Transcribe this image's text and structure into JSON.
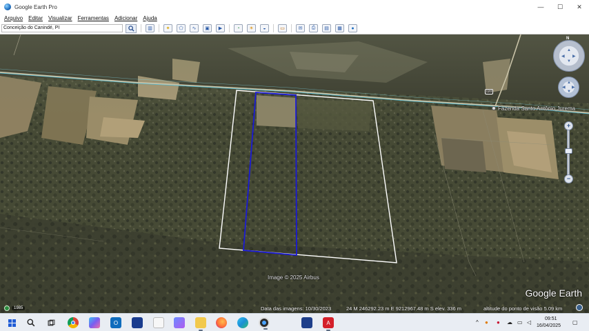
{
  "window": {
    "title": "Google Earth Pro",
    "controls": {
      "minimize": "—",
      "maximize": "☐",
      "close": "✕"
    }
  },
  "menu": {
    "items": [
      "Arquivo",
      "Editar",
      "Visualizar",
      "Ferramentas",
      "Adicionar",
      "Ajuda"
    ]
  },
  "toolbar": {
    "search_value": "Conceição do Canindé, PI",
    "icons": [
      "sidebar-toggle-icon",
      "placemark-icon",
      "polygon-icon",
      "path-icon",
      "image-overlay-icon",
      "record-tour-icon",
      "historical-imagery-icon",
      "sunlight-icon",
      "planets-icon",
      "ruler-icon",
      "email-icon",
      "print-icon",
      "save-image-icon",
      "view-in-maps-icon",
      "earth-globe-icon"
    ]
  },
  "map": {
    "imagery_credit": "Image © 2025 Airbus",
    "logo_text": "Google Earth",
    "road_marker": "020",
    "place_label": "Fazenda Santo Antônio Jurema",
    "compass_north": "N"
  },
  "status": {
    "year": "1985",
    "imagery_date": "Data das imagens: 10/30/2023",
    "coordinates": "24 M 246292.23 m E 9212967.48 m S   elev.  336 m",
    "eye_altitude": "altitude do ponto de visão   5.09 km"
  },
  "taskbar": {
    "time": "09:51",
    "date": "16/04/2025",
    "apps": [
      {
        "name": "start-button",
        "color": "#1e5bd6",
        "glyph": "⊞"
      },
      {
        "name": "search-button",
        "color": "#e9edf3",
        "glyph": "⌕"
      },
      {
        "name": "task-view-button",
        "color": "#e9edf3",
        "glyph": "▭"
      },
      {
        "name": "chrome-app",
        "color": "#db4437",
        "glyph": "●"
      },
      {
        "name": "copilot-app",
        "color": "#7a5cf0",
        "glyph": "◆"
      },
      {
        "name": "outlook-app",
        "color": "#0f6cbd",
        "glyph": "O"
      },
      {
        "name": "news-app",
        "color": "#1a3c8e",
        "glyph": "■"
      },
      {
        "name": "file-app",
        "color": "#f1f1f1",
        "glyph": "▯"
      },
      {
        "name": "copilot-alt-app",
        "color": "#9b5de5",
        "glyph": "◈"
      },
      {
        "name": "file-explorer-app",
        "color": "#f2c94c",
        "glyph": "▬"
      },
      {
        "name": "firefox-app",
        "color": "#ff7139",
        "glyph": "●"
      },
      {
        "name": "edge-app",
        "color": "#1b8fd6",
        "glyph": "◐"
      },
      {
        "name": "earth-pro-app",
        "color": "#2b2b2b",
        "glyph": "◉"
      },
      {
        "name": "monitor-app",
        "color": "#1e3f8a",
        "glyph": "▤"
      },
      {
        "name": "acrobat-app",
        "color": "#d4202a",
        "glyph": "A"
      }
    ],
    "tray": [
      "chevron-up-icon",
      "weather-icon",
      "antivirus-icon",
      "onedrive-icon",
      "network-icon",
      "volume-icon",
      "notification-icon"
    ]
  }
}
